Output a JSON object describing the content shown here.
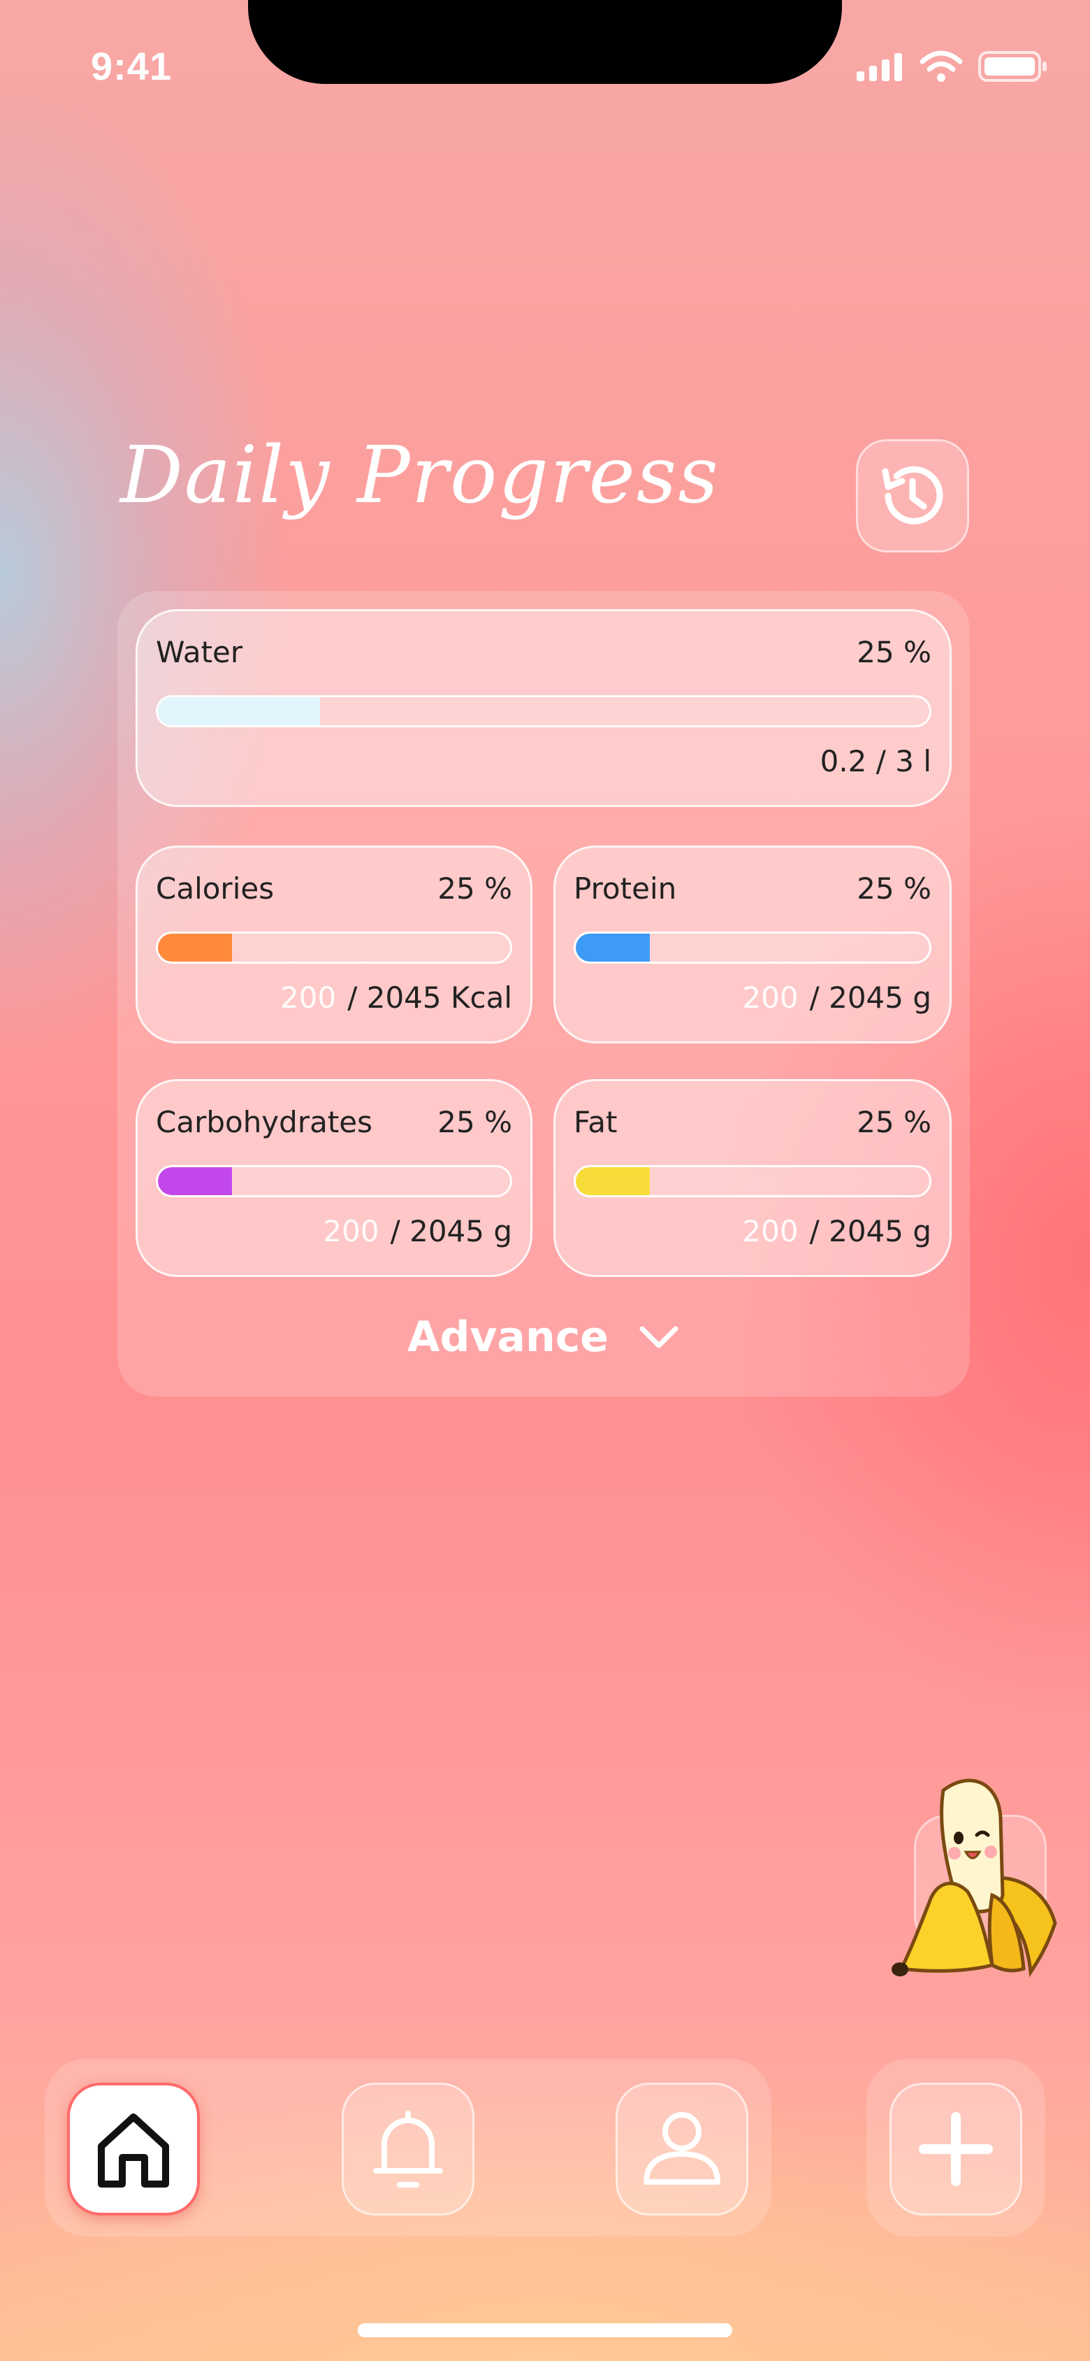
{
  "status_bar": {
    "time": "9:41"
  },
  "header": {
    "title": "Daily Progress",
    "history_icon": "history-icon"
  },
  "water": {
    "name": "Water",
    "percent_label": "25 %",
    "amount": "0.2 / 3 l",
    "progress": 0.21,
    "color": "#e1f6fc"
  },
  "calories": {
    "name": "Calories",
    "percent_label": "25 %",
    "current": "200",
    "total": "/ 2045 Kcal",
    "progress": 0.21,
    "color": "#ff8a3c"
  },
  "protein": {
    "name": "Protein",
    "percent_label": "25 %",
    "current": "200",
    "total": "/ 2045 g",
    "progress": 0.21,
    "color": "#3d9bf5"
  },
  "carbohydrates": {
    "name": "Carbohydrates",
    "percent_label": "25 %",
    "current": "200",
    "total": "/ 2045 g",
    "progress": 0.21,
    "color": "#c348ec"
  },
  "fat": {
    "name": "Fat",
    "percent_label": "25 %",
    "current": "200",
    "total": "/ 2045 g",
    "progress": 0.21,
    "color": "#f8dd3a"
  },
  "advance": {
    "label": "Advance",
    "icon": "chevron-down-icon"
  },
  "nav": {
    "items": [
      {
        "icon": "home-icon",
        "active": true
      },
      {
        "icon": "bell-icon",
        "active": false
      },
      {
        "icon": "user-icon",
        "active": false
      }
    ],
    "add_icon": "plus-icon"
  },
  "colors": {
    "accent": "#ff6a6a",
    "text": "#222222"
  }
}
